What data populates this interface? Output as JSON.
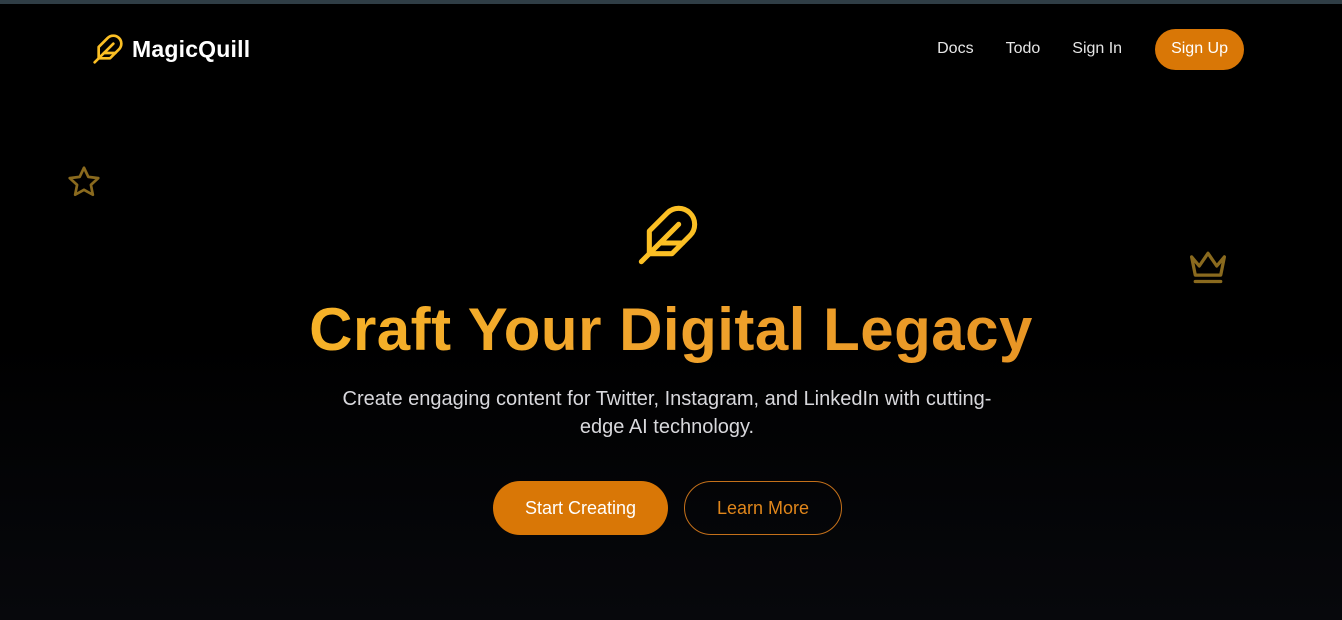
{
  "brand": {
    "name": "MagicQuill",
    "icon": "feather-icon"
  },
  "nav": {
    "links": [
      "Docs",
      "Todo",
      "Sign In"
    ],
    "signup_label": "Sign Up"
  },
  "decorations": {
    "left_icon": "star-icon",
    "right_icon": "crown-icon"
  },
  "hero": {
    "icon": "feather-icon",
    "title": "Craft Your Digital Legacy",
    "subtitle": "Create engaging content for Twitter, Instagram, and LinkedIn with cutting-edge AI technology.",
    "primary_cta": "Start Creating",
    "secondary_cta": "Learn More"
  },
  "colors": {
    "background": "#000000",
    "accent": "#d97706",
    "gold": "#fbbf24",
    "text": "#ffffff",
    "muted_text": "#d8d8dc"
  }
}
